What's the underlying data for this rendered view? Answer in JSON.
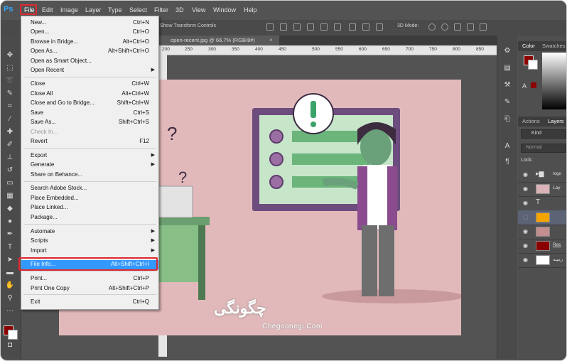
{
  "app": {
    "logo": "Ps"
  },
  "menubar": {
    "items": [
      "File",
      "Edit",
      "Image",
      "Layer",
      "Type",
      "Select",
      "Filter",
      "3D",
      "View",
      "Window",
      "Help"
    ]
  },
  "options_bar": {
    "auto_select": "3D Mode:",
    "transform_controls": "Show Transform Controls"
  },
  "document": {
    "tab_title": "open-recent.jpg @ 66.7% (RGB/8#)",
    "tab_close": "×",
    "ruler_labels": [
      "200",
      "250",
      "300",
      "350",
      "400",
      "450",
      "500",
      "550",
      "600",
      "650",
      "700",
      "750",
      "800",
      "850"
    ]
  },
  "file_menu": {
    "items": [
      {
        "label": "New...",
        "shortcut": "Ctrl+N"
      },
      {
        "label": "Open...",
        "shortcut": "Ctrl+O"
      },
      {
        "label": "Browse in Bridge...",
        "shortcut": "Alt+Ctrl+O"
      },
      {
        "label": "Open As...",
        "shortcut": "Alt+Shift+Ctrl+O"
      },
      {
        "label": "Open as Smart Object...",
        "shortcut": ""
      },
      {
        "label": "Open Recent",
        "shortcut": "",
        "submenu": true
      },
      {
        "label": "Close",
        "shortcut": "Ctrl+W"
      },
      {
        "label": "Close All",
        "shortcut": "Alt+Ctrl+W"
      },
      {
        "label": "Close and Go to Bridge...",
        "shortcut": "Shift+Ctrl+W"
      },
      {
        "label": "Save",
        "shortcut": "Ctrl+S"
      },
      {
        "label": "Save As...",
        "shortcut": "Shift+Ctrl+S"
      },
      {
        "label": "Check In...",
        "shortcut": "",
        "disabled": true
      },
      {
        "label": "Revert",
        "shortcut": "F12"
      },
      {
        "label": "Export",
        "shortcut": "",
        "submenu": true
      },
      {
        "label": "Generate",
        "shortcut": "",
        "submenu": true
      },
      {
        "label": "Share on Behance...",
        "shortcut": ""
      },
      {
        "label": "Search Adobe Stock...",
        "shortcut": ""
      },
      {
        "label": "Place Embedded...",
        "shortcut": ""
      },
      {
        "label": "Place Linked...",
        "shortcut": ""
      },
      {
        "label": "Package...",
        "shortcut": ""
      },
      {
        "label": "Automate",
        "shortcut": "",
        "submenu": true
      },
      {
        "label": "Scripts",
        "shortcut": "",
        "submenu": true
      },
      {
        "label": "Import",
        "shortcut": "",
        "submenu": true
      },
      {
        "label": "File Info...",
        "shortcut": "Alt+Shift+Ctrl+I",
        "selected": true
      },
      {
        "label": "Print...",
        "shortcut": "Ctrl+P"
      },
      {
        "label": "Print One Copy",
        "shortcut": "Alt+Shift+Ctrl+P"
      },
      {
        "label": "Exit",
        "shortcut": "Ctrl+Q"
      }
    ]
  },
  "panels": {
    "color_tabs": [
      "Color",
      "Swatches"
    ],
    "layer_tabs": [
      "Actions",
      "Layers"
    ],
    "filter_label": "Kind",
    "blend_mode": "Normal",
    "lock_label": "Lock:",
    "layers": [
      {
        "name": "logo",
        "type": "group"
      },
      {
        "name": "Lay",
        "type": "image"
      },
      {
        "name": "T",
        "type": "text"
      },
      {
        "name": "",
        "type": "fill-orange"
      },
      {
        "name": "",
        "type": "image-small"
      },
      {
        "name": "Rec",
        "type": "shape-red"
      },
      {
        "name": "زمینه",
        "type": "background"
      }
    ]
  },
  "colors": {
    "accent": "#e0282f",
    "selection": "#3399ff",
    "foreground": "#8b0000",
    "canvas": "#e2b9bb"
  },
  "watermark": {
    "text": "Chegoonegi.Com",
    "text_fa": "چگونگی"
  }
}
